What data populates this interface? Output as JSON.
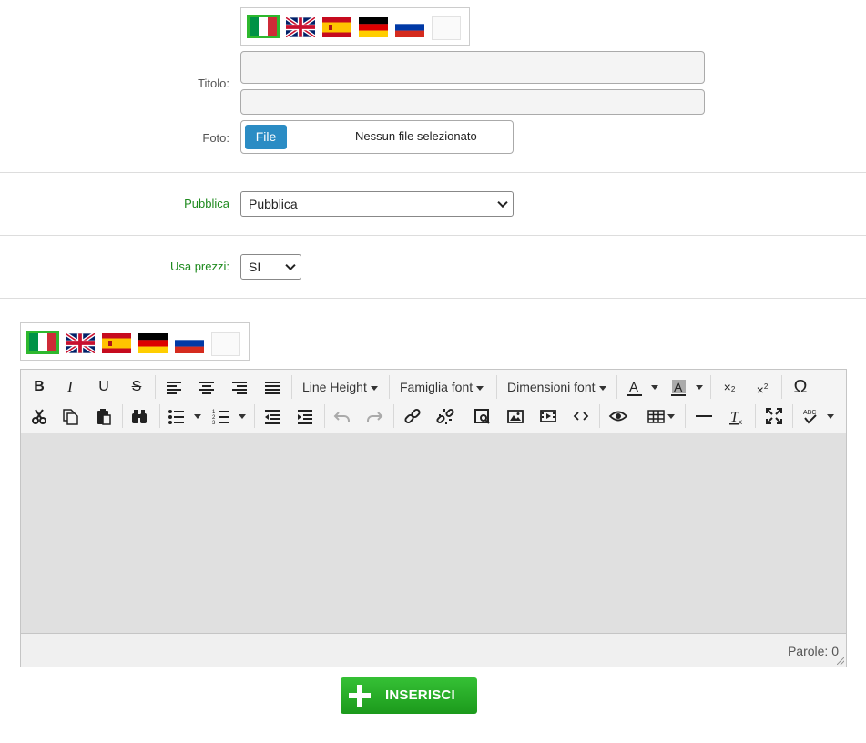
{
  "form": {
    "title_label": "Titolo:",
    "photo_label": "Foto:",
    "file_button": "File",
    "file_status": "Nessun file selezionato",
    "publish_label": "Pubblica",
    "publish_value": "Pubblica",
    "prices_label": "Usa prezzi:",
    "prices_value": "SI"
  },
  "flags": [
    "italy-flag-icon",
    "uk-flag-icon",
    "spain-flag-icon",
    "germany-flag-icon",
    "russia-flag-icon",
    "empty-flag-icon"
  ],
  "editor": {
    "line_height": "Line Height",
    "font_family": "Famiglia font",
    "font_size": "Dimensioni font",
    "word_count": "Parole: 0"
  },
  "submit_label": "INSERISCI",
  "colors": {
    "accent_green": "#1e8a1e",
    "file_button_blue": "#2b8cc4",
    "submit_green": "#2aad2a"
  }
}
